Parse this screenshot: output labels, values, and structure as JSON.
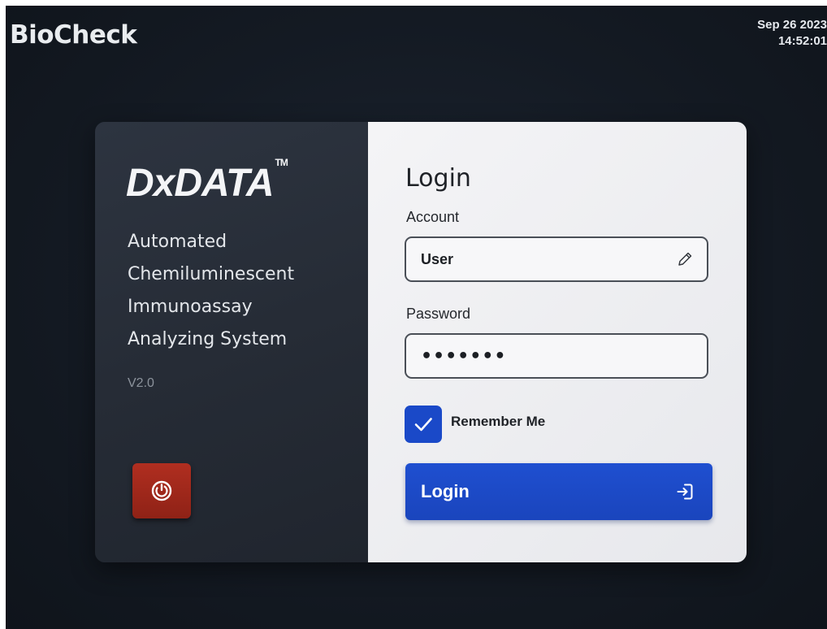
{
  "header": {
    "brand": "BioCheck",
    "date": "Sep 26 2023",
    "time": "14:52:01"
  },
  "left_panel": {
    "product_name": "DxDATA",
    "trademark": "TM",
    "system_lines": [
      "Automated",
      "Chemiluminescent",
      "Immunoassay",
      "Analyzing System"
    ],
    "version": "V2.0",
    "power_icon": "power-icon",
    "power_color": "#a3281b"
  },
  "login_form": {
    "title": "Login",
    "account_label": "Account",
    "account_value": "User",
    "account_icon": "pencil-icon",
    "password_label": "Password",
    "password_value": "•••••••",
    "remember_label": "Remember Me",
    "remember_checked": true,
    "login_button_label": "Login",
    "login_icon": "sign-in-icon",
    "accent_color": "#1a49c8"
  }
}
